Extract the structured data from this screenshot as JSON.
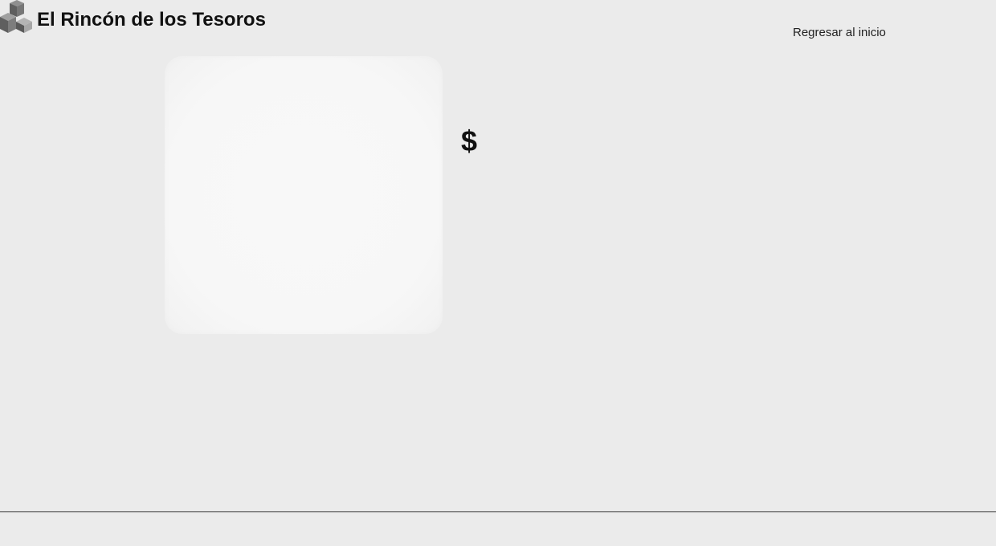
{
  "header": {
    "logo_icon": "cubes-logo-icon",
    "site_title": "El Rincón de los Tesoros",
    "home_link": "Regresar al inicio"
  },
  "product": {
    "image_icon": "product-image-placeholder",
    "price": "$"
  },
  "colors": {
    "background": "#ebebeb",
    "image_background": "#f7f7f7",
    "text": "#111111",
    "divider": "#333333"
  }
}
